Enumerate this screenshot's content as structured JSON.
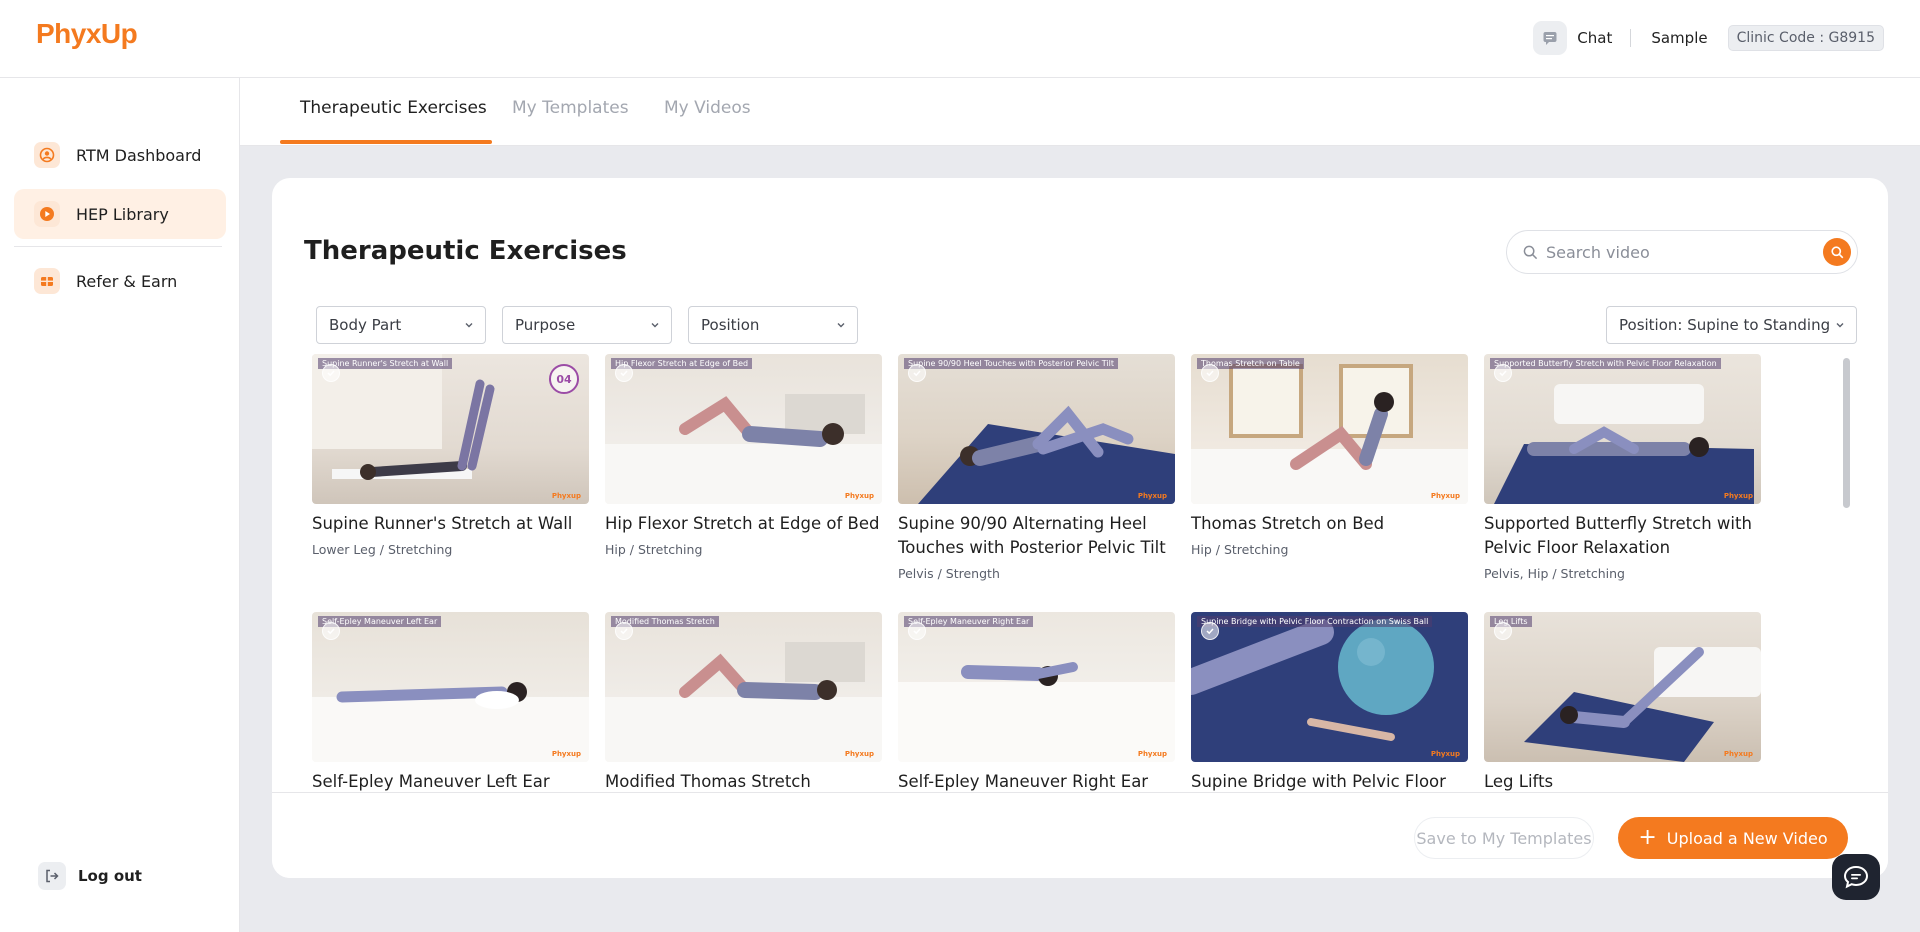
{
  "header": {
    "logo": "PhyxUp",
    "chat_label": "Chat",
    "user_name": "Sample",
    "clinic_code": "Clinic Code : G8915"
  },
  "sidebar": {
    "items": [
      {
        "label": "RTM Dashboard",
        "icon": "user-circle-icon",
        "active": false
      },
      {
        "label": "HEP Library",
        "icon": "play-circle-icon",
        "active": true
      },
      {
        "label": "Refer & Earn",
        "icon": "gift-icon",
        "active": false
      }
    ],
    "logout_label": "Log out"
  },
  "tabs": [
    {
      "label": "Therapeutic Exercises",
      "active": true
    },
    {
      "label": "My Templates",
      "active": false
    },
    {
      "label": "My Videos",
      "active": false
    }
  ],
  "main": {
    "title": "Therapeutic Exercises",
    "search_placeholder": "Search video",
    "filters": {
      "body_part": "Body Part",
      "purpose": "Purpose",
      "position": "Position",
      "sort": "Position: Supine to Standing"
    },
    "videos": [
      {
        "title": "Supine Runner's Stretch at Wall",
        "meta": "Lower Leg / Stretching",
        "caption": "Supine Runner's Stretch at Wall",
        "badge": "04"
      },
      {
        "title": "Hip Flexor Stretch at Edge of Bed",
        "meta": "Hip / Stretching",
        "caption": "Hip Flexor Stretch at Edge of Bed",
        "badge": ""
      },
      {
        "title": "Supine 90/90 Alternating Heel Touches with Posterior Pelvic Tilt",
        "meta": "Pelvis / Strength",
        "caption": "Supine 90/90 Heel Touches with Posterior Pelvic Tilt",
        "badge": ""
      },
      {
        "title": "Thomas Stretch on Bed",
        "meta": "Hip / Stretching",
        "caption": "Thomas Stretch on Table",
        "badge": ""
      },
      {
        "title": "Supported Butterfly Stretch with Pelvic Floor Relaxation",
        "meta": "Pelvis, Hip / Stretching",
        "caption": "Supported Butterfly Stretch with Pelvic Floor Relaxation",
        "badge": ""
      },
      {
        "title": "Self-Epley Maneuver Left Ear",
        "meta": "",
        "caption": "Self-Epley Maneuver Left Ear",
        "badge": ""
      },
      {
        "title": "Modified Thomas Stretch",
        "meta": "",
        "caption": "Modified Thomas Stretch",
        "badge": ""
      },
      {
        "title": "Self-Epley Maneuver Right Ear",
        "meta": "",
        "caption": "Self-Epley Maneuver Right Ear",
        "badge": ""
      },
      {
        "title": "Supine Bridge with Pelvic Floor",
        "meta": "",
        "caption": "Supine Bridge with Pelvic Floor Contraction on Swiss Ball",
        "badge": ""
      },
      {
        "title": "Leg Lifts",
        "meta": "",
        "caption": "Leg Lifts",
        "badge": ""
      }
    ],
    "brand_watermark": "Phyxup"
  },
  "footer": {
    "save_label": "Save to My Templates",
    "upload_label": "Upload a New Video"
  },
  "colors": {
    "accent": "#f47a1f",
    "active_nav_bg": "#fff0e4",
    "background": "#e9eaee"
  }
}
